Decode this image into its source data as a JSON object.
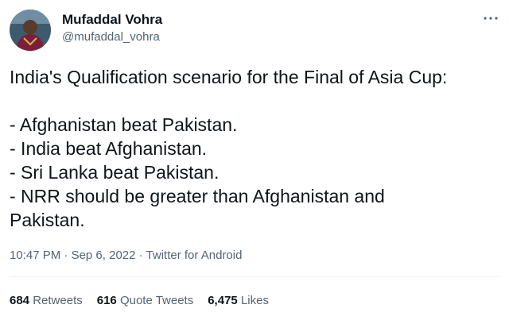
{
  "user": {
    "display_name": "Mufaddal Vohra",
    "handle": "@mufaddal_vohra"
  },
  "more_icon": "ellipsis-icon",
  "tweet": {
    "lines": [
      "India's Qualification scenario for the Final of Asia Cup:",
      "",
      "- Afghanistan beat Pakistan.",
      "- India beat Afghanistan.",
      "- Sri Lanka beat Pakistan.",
      "- NRR should be greater than Afghanistan and",
      "Pakistan."
    ]
  },
  "meta": {
    "time": "10:47 PM",
    "separator": " · ",
    "date": "Sep 6, 2022",
    "separator2": " · ",
    "source": "Twitter for Android"
  },
  "stats": {
    "retweets": {
      "count": "684",
      "label": "Retweets"
    },
    "quotes": {
      "count": "616",
      "label": "Quote Tweets"
    },
    "likes": {
      "count": "6,475",
      "label": "Likes"
    }
  },
  "colors": {
    "text": "#0f1419",
    "secondary": "#536471",
    "divider": "#eff3f4"
  }
}
